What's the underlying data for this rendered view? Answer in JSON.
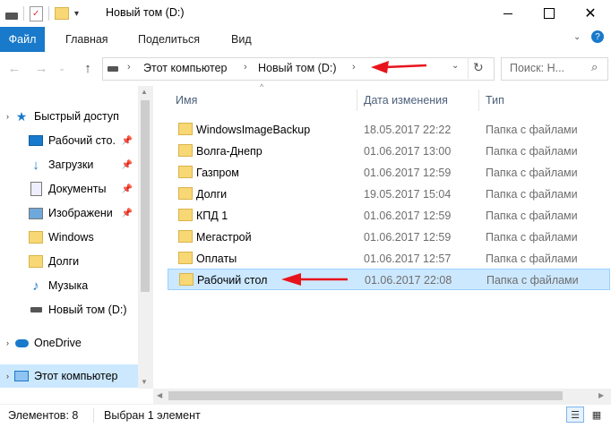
{
  "window": {
    "title": "Новый том (D:)"
  },
  "ribbon": {
    "tabs": [
      "Файл",
      "Главная",
      "Поделиться",
      "Вид"
    ]
  },
  "address": {
    "crumbs": [
      "Этот компьютер",
      "Новый том (D:)"
    ]
  },
  "search": {
    "placeholder": "Поиск: Н..."
  },
  "columns": {
    "name": "Имя",
    "date": "Дата изменения",
    "type": "Тип"
  },
  "sidebar": {
    "items": [
      {
        "label": "Быстрый доступ",
        "icon": "star-icon"
      },
      {
        "label": "Рабочий сто.",
        "icon": "desktop-icon",
        "pinned": true
      },
      {
        "label": "Загрузки",
        "icon": "download-icon",
        "pinned": true
      },
      {
        "label": "Документы",
        "icon": "document-icon",
        "pinned": true
      },
      {
        "label": "Изображени",
        "icon": "image-icon",
        "pinned": true
      },
      {
        "label": "Windows",
        "icon": "folder-icon"
      },
      {
        "label": "Долги",
        "icon": "folder-icon"
      },
      {
        "label": "Музыка",
        "icon": "music-icon"
      },
      {
        "label": "Новый том (D:)",
        "icon": "drive-icon"
      },
      {
        "label": "OneDrive",
        "icon": "cloud-icon"
      },
      {
        "label": "Этот компьютер",
        "icon": "computer-icon",
        "selected": true
      }
    ]
  },
  "files": [
    {
      "name": "WindowsImageBackup",
      "date": "18.05.2017 22:22",
      "type": "Папка с файлами"
    },
    {
      "name": "Волга-Днепр",
      "date": "01.06.2017 13:00",
      "type": "Папка с файлами"
    },
    {
      "name": "Газпром",
      "date": "01.06.2017 12:59",
      "type": "Папка с файлами"
    },
    {
      "name": "Долги",
      "date": "19.05.2017 15:04",
      "type": "Папка с файлами"
    },
    {
      "name": "КПД 1",
      "date": "01.06.2017 12:59",
      "type": "Папка с файлами"
    },
    {
      "name": "Мегастрой",
      "date": "01.06.2017 12:59",
      "type": "Папка с файлами"
    },
    {
      "name": "Оплаты",
      "date": "01.06.2017 12:57",
      "type": "Папка с файлами"
    },
    {
      "name": "Рабочий стол",
      "date": "01.06.2017 22:08",
      "type": "Папка с файлами",
      "selected": true
    }
  ],
  "status": {
    "count": "Элементов: 8",
    "selected": "Выбран 1 элемент"
  },
  "colors": {
    "accent": "#1979ca",
    "selection": "#cce8ff",
    "folder": "#f8d775",
    "annotation_arrow": "#e8141b"
  }
}
